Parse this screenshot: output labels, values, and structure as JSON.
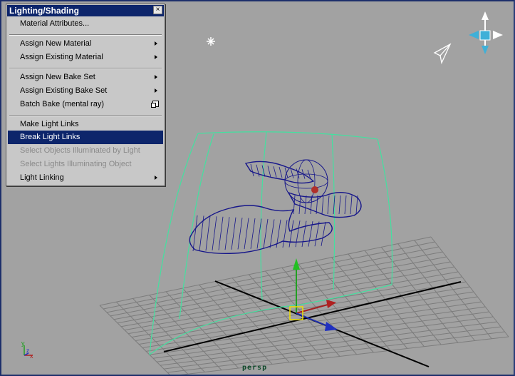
{
  "menu": {
    "title": "Lighting/Shading",
    "close_glyph": "×",
    "items": [
      {
        "label": "Material Attributes...",
        "submenu": false,
        "enabled": true
      },
      {
        "label": "Assign New Material",
        "submenu": true,
        "enabled": true
      },
      {
        "label": "Assign Existing Material",
        "submenu": true,
        "enabled": true
      },
      {
        "label": "Assign New Bake Set",
        "submenu": true,
        "enabled": true
      },
      {
        "label": "Assign Existing Bake Set",
        "submenu": true,
        "enabled": true
      },
      {
        "label": "Batch Bake (mental ray)",
        "submenu": false,
        "option_box": true,
        "enabled": true
      },
      {
        "label": "Make Light Links",
        "submenu": false,
        "enabled": true
      },
      {
        "label": "Break Light Links",
        "submenu": false,
        "enabled": true,
        "highlighted": true
      },
      {
        "label": "Select Objects Illuminated by Light",
        "submenu": false,
        "enabled": false
      },
      {
        "label": "Select Lights Illuminating Object",
        "submenu": false,
        "enabled": false
      },
      {
        "label": "Light Linking",
        "submenu": true,
        "enabled": true
      }
    ]
  },
  "viewport": {
    "camera_label": "persp",
    "axis_labels": {
      "y": "y",
      "x": "x",
      "z": "z"
    },
    "colors": {
      "background": "#a2a2a2",
      "grid": "#7c7c7c",
      "grid_axis": "#000000",
      "wireframe": "#16168a",
      "light_frame": "#44e0a0",
      "highlight": "#0d256b"
    }
  }
}
